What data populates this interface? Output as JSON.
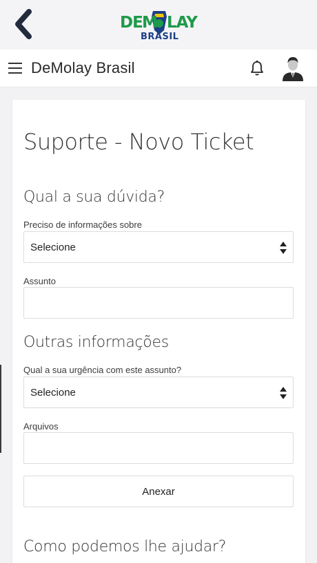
{
  "header": {
    "back_icon": "chevron-left-icon",
    "logo_top": "DEMOLAY",
    "logo_bottom": "BRASIL",
    "colors": {
      "logo_green": "#1f9a4a",
      "logo_navy": "#1d3f86",
      "logo_gold": "#f5c400",
      "back_arrow": "#232b3d"
    }
  },
  "navbar": {
    "menu_icon": "hamburger-menu-icon",
    "title": "DeMolay Brasil",
    "bell_icon": "bell-icon",
    "avatar_icon": "user-avatar-icon"
  },
  "form": {
    "page_title": "Suporte - Novo Ticket",
    "section1_title": "Qual a sua dúvida?",
    "info_label": "Preciso de informações sobre",
    "info_value": "Selecione",
    "subject_label": "Assunto",
    "subject_value": "",
    "section2_title": "Outras informações",
    "urgency_label": "Qual a sua urgência com este assunto?",
    "urgency_value": "Selecione",
    "files_label": "Arquivos",
    "files_value": "",
    "attach_label": "Anexar",
    "section3_title": "Como podemos lhe ajudar?"
  }
}
